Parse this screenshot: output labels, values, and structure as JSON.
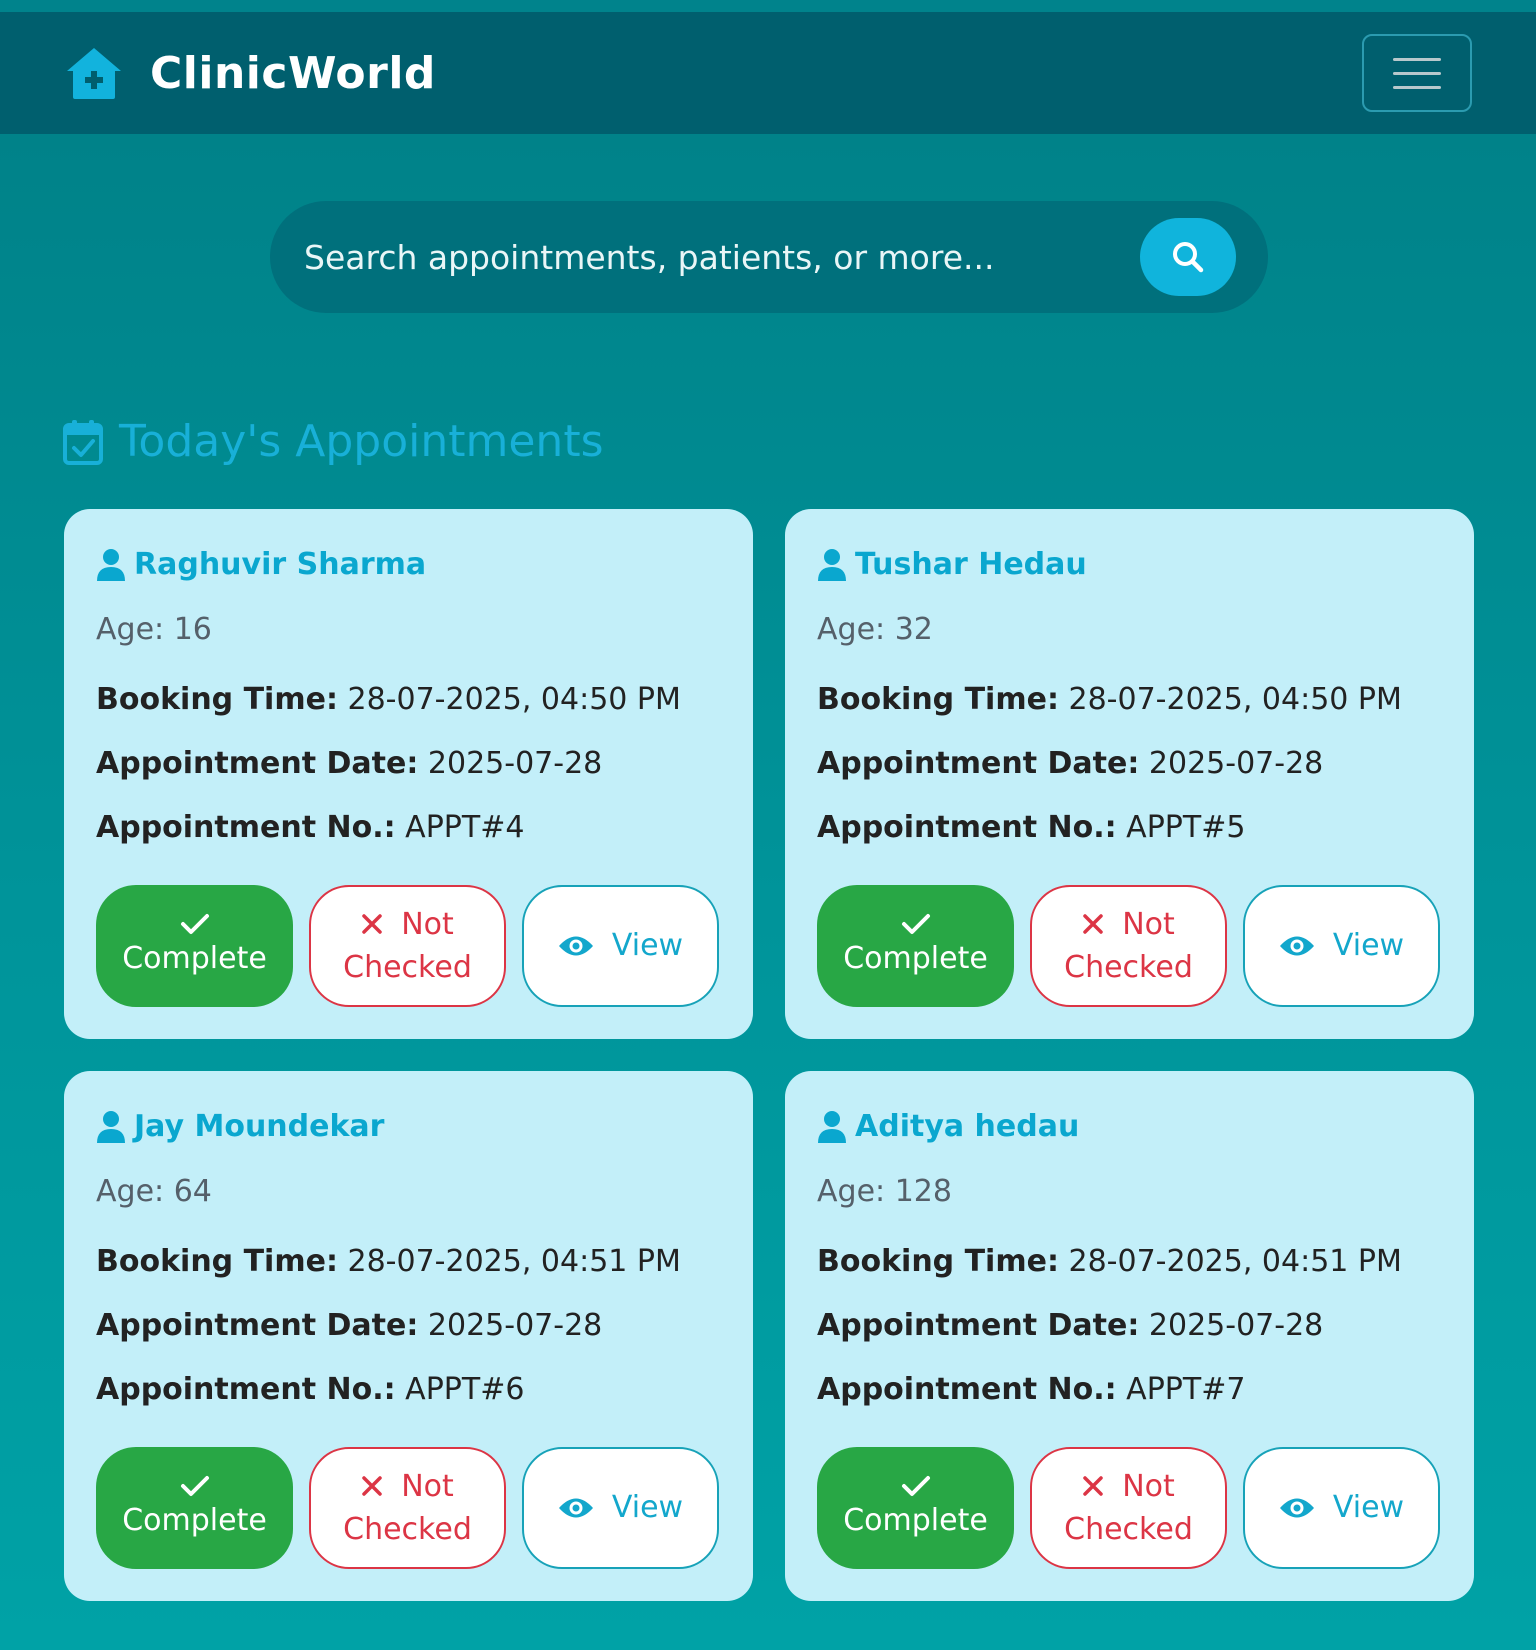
{
  "nav": {
    "brand": "ClinicWorld",
    "brand_icon": "clinic-house-icon",
    "menu_icon": "hamburger-icon"
  },
  "search": {
    "placeholder": "Search appointments, patients, or more...",
    "icon": "search-icon"
  },
  "section": {
    "title": "Today's Appointments",
    "icon": "calendar-check-icon"
  },
  "labels": {
    "age": "Age:",
    "booking_time": "Booking Time:",
    "appointment_date": "Appointment Date:",
    "appointment_no": "Appointment No.:"
  },
  "buttons": {
    "complete": "Complete",
    "not_checked_1": "Not",
    "not_checked_2": "Checked",
    "view": "View"
  },
  "appointments": [
    {
      "name": "Raghuvir Sharma",
      "age": "16",
      "booking_time": "28-07-2025, 04:50 PM",
      "appointment_date": "2025-07-28",
      "appointment_no": "APPT#4"
    },
    {
      "name": "Tushar Hedau",
      "age": "32",
      "booking_time": "28-07-2025, 04:50 PM",
      "appointment_date": "2025-07-28",
      "appointment_no": "APPT#5"
    },
    {
      "name": "Jay Moundekar",
      "age": "64",
      "booking_time": "28-07-2025, 04:51 PM",
      "appointment_date": "2025-07-28",
      "appointment_no": "APPT#6"
    },
    {
      "name": "Aditya hedau",
      "age": "128",
      "booking_time": "28-07-2025, 04:51 PM",
      "appointment_date": "2025-07-28",
      "appointment_no": "APPT#7"
    }
  ],
  "colors": {
    "navbar": "#005f6e",
    "accent": "#10b4dc",
    "card": "#c3eff9",
    "complete": "#28a745",
    "not_checked": "#dc3545",
    "view": "#17a2b8"
  }
}
